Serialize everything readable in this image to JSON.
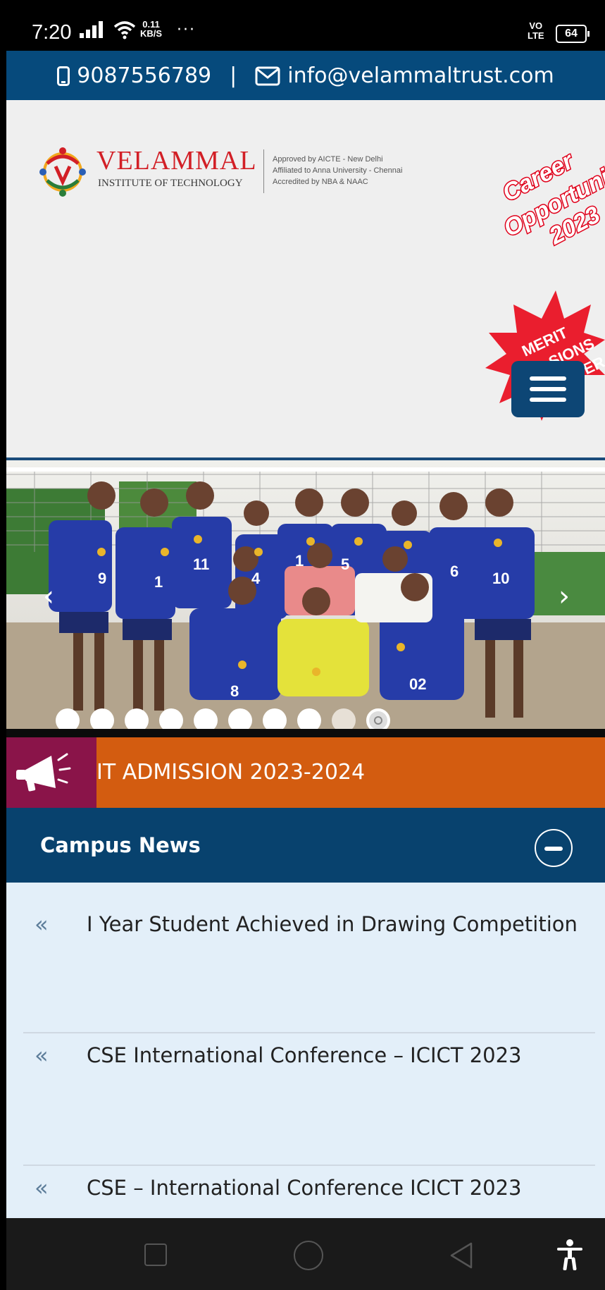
{
  "status_bar": {
    "time": "7:20",
    "net_speed_value": "0.11",
    "net_speed_unit": "KB/S",
    "more": "···",
    "volte_top": "VO",
    "volte_bottom": "LTE",
    "battery": "64"
  },
  "contact_bar": {
    "phone": "9087556789",
    "separator": "|",
    "email": "info@velammaltrust.com"
  },
  "header": {
    "logo_name": "VELAMMAL",
    "logo_sub": "INSTITUTE OF TECHNOLOGY",
    "accreditation": [
      "Approved by AICTE - New Delhi",
      "Affiliated  to Anna University - Chennai",
      "Accredited by NBA & NAAC"
    ],
    "career_badge": [
      "Career",
      "Opportuni",
      "2023"
    ],
    "merit_badge": [
      "MERIT",
      "SIONS",
      "STER"
    ]
  },
  "carousel": {
    "prev": "‹",
    "next": "›",
    "slide_count": 10,
    "active_slide": 10,
    "jersey_numbers": [
      "9",
      "1",
      "11",
      "1",
      "5",
      "6",
      "10",
      "8",
      "02",
      "4"
    ]
  },
  "ticker": {
    "text": "IT ADMISSION 2023-2024"
  },
  "campus_news": {
    "title": "Campus News",
    "items": [
      "I Year Student Achieved in Drawing Competition",
      "CSE International Conference – ICICT 2023",
      "CSE – International Conference ICICT 2023"
    ],
    "bullet": "«"
  },
  "colors": {
    "brand_blue": "#064a7c",
    "ticker_orange": "#d35c10",
    "ticker_icon_bg": "#8a1449",
    "logo_red": "#d21f26",
    "news_bg": "#e3eff9"
  }
}
